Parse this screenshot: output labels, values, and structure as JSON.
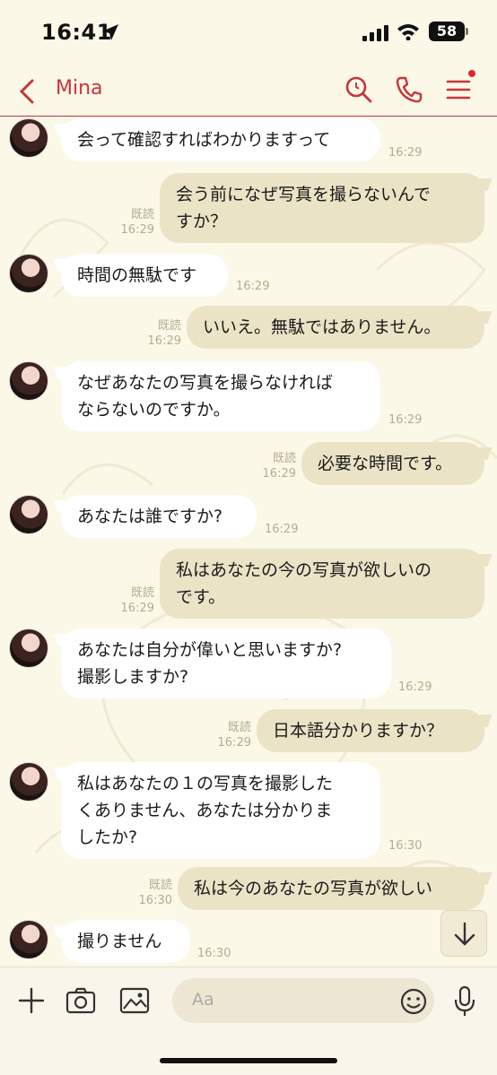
{
  "status_bar": {
    "time": "16:41",
    "battery": "58"
  },
  "header": {
    "title": "Mina"
  },
  "messages": [
    {
      "side": "in",
      "text": "会って確認すればわかりますって",
      "time": "16:29"
    },
    {
      "side": "out",
      "text": "会う前になぜ写真を撮らないんで\nすか？",
      "read": "既読",
      "time": "16:29"
    },
    {
      "side": "in",
      "text": "時間の無駄です",
      "time": "16:29"
    },
    {
      "side": "out",
      "text": "いいえ。無駄ではありません。",
      "read": "既読",
      "time": "16:29"
    },
    {
      "side": "in",
      "text": "なぜあなたの写真を撮らなければ\nならないのですか。",
      "time": "16:29"
    },
    {
      "side": "out",
      "text": "必要な時間です。",
      "read": "既読",
      "time": "16:29"
    },
    {
      "side": "in",
      "text": "あなたは誰ですか?",
      "time": "16:29"
    },
    {
      "side": "out",
      "text": "私はあなたの今の写真が欲しいの\nです。",
      "read": "既読",
      "time": "16:29"
    },
    {
      "side": "in",
      "text": "あなたは自分が偉いと思いますか?\n撮影しますか?",
      "time": "16:29"
    },
    {
      "side": "out",
      "text": "日本語分かりますか？",
      "read": "既読",
      "time": "16:29"
    },
    {
      "side": "in",
      "text": "私はあなたの１の写真を撮影した\nくありません、あなたは分かりま\nしたか?",
      "time": "16:30"
    },
    {
      "side": "out",
      "text": "私は今のあなたの写真が欲しい",
      "read": "既読",
      "time": "16:30"
    },
    {
      "side": "in",
      "text": "撮りません",
      "time": "16:30"
    }
  ],
  "input": {
    "placeholder": "Aa"
  },
  "colors": {
    "accent": "#c8343a",
    "background": "#fbf8e8",
    "outgoing_bubble": "#ebe3c6",
    "incoming_bubble": "#ffffff"
  },
  "icons": [
    "location-arrow-icon",
    "signal-icon",
    "wifi-icon",
    "battery-icon",
    "back-icon",
    "search-icon",
    "call-icon",
    "menu-icon",
    "plus-icon",
    "camera-icon",
    "image-icon",
    "emoji-icon",
    "mic-icon",
    "chevron-down-icon"
  ]
}
